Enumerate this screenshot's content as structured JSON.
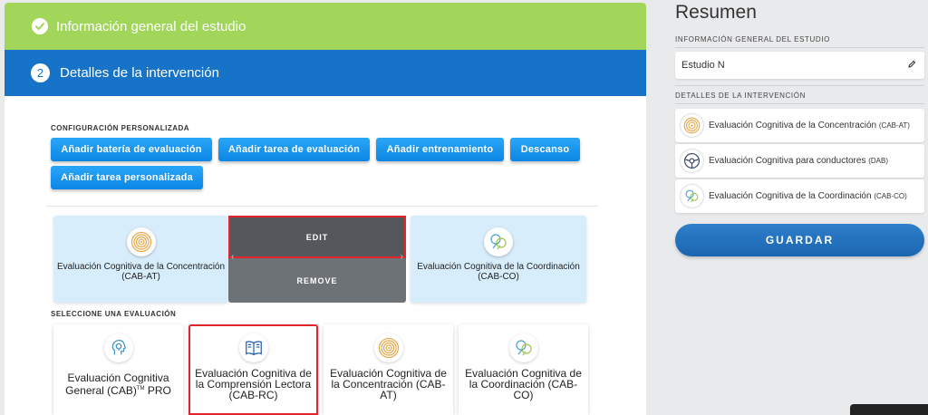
{
  "steps": {
    "step1_title": "Información general del estudio",
    "step2_number": "2",
    "step2_title": "Detalles de la intervención"
  },
  "custom_config": {
    "label": "CONFIGURACIÓN PERSONALIZADA",
    "buttons": {
      "add_battery": "Añadir batería de evaluación",
      "add_eval_task": "Añadir tarea de evaluación",
      "add_training": "Añadir entrenamiento",
      "rest": "Descanso",
      "add_custom_task": "Añadir tarea personalizada"
    }
  },
  "selected_cards": [
    {
      "name": "Evaluación Cognitiva de la Concentración (CAB-AT)",
      "icon": "concentric-circles-icon",
      "color": "#e7a84a"
    },
    {
      "name": "Evaluación Cognitiva para conductores (DAB)",
      "icon": "steering-wheel-icon",
      "color": "#3a4a6b"
    },
    {
      "name": "Evaluación Cognitiva de la Coordinación (CAB-CO)",
      "icon": "hands-icon",
      "color": "#4aa3c8"
    }
  ],
  "card_overlay": {
    "edit": "EDIT",
    "remove": "REMOVE"
  },
  "select_eval": {
    "label": "SELECCIONE UNA EVALUACIÓN",
    "cards": [
      {
        "name": "Evaluación Cognitiva General (CAB)",
        "suffix": "TM",
        "tail": " PRO",
        "icon": "head-icon"
      },
      {
        "name": "Evaluación Cognitiva de la Comprensión Lectora (CAB-RC)",
        "icon": "book-icon",
        "highlighted": true
      },
      {
        "name": "Evaluación Cognitiva de la Concentración (CAB-AT)",
        "icon": "concentric-circles-icon"
      },
      {
        "name": "Evaluación Cognitiva de la Coordinación (CAB-CO)",
        "icon": "hands-icon"
      }
    ]
  },
  "summary": {
    "title": "Resumen",
    "general_label": "INFORMACIÓN GENERAL DEL ESTUDIO",
    "study_name": "Estudio N",
    "details_label": "DETALLES DE LA INTERVENCIÓN",
    "items": [
      {
        "main": "Evaluación Cognitiva de la Concentración ",
        "code": "(CAB-AT)"
      },
      {
        "main": "Evaluación Cognitiva para conductores ",
        "code": "(DAB)"
      },
      {
        "main": "Evaluación Cognitiva de la Coordinación ",
        "code": "(CAB-CO)"
      }
    ],
    "save": "GUARDAR"
  },
  "colors": {
    "step1_green": "#a1d65a",
    "step2_blue": "#1673c7",
    "button_blue": "#1a8cf0",
    "highlight_red": "#e2252b",
    "selected_card_bg": "#d8edfb"
  }
}
